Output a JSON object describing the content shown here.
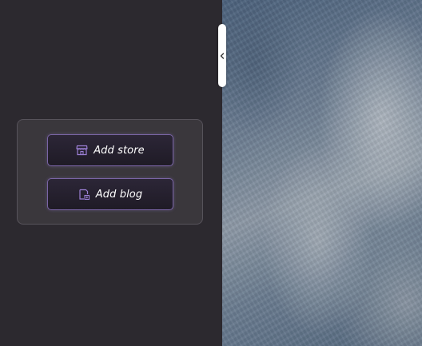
{
  "sidebar": {
    "actions": [
      {
        "label": "Add store",
        "icon": "store-icon"
      },
      {
        "label": "Add blog",
        "icon": "blog-add-icon"
      }
    ]
  },
  "handle": {
    "icon": "chevron-left-icon"
  },
  "colors": {
    "panel_bg": "#2c292f",
    "card_bg": "#3a373c",
    "button_border": "#7a65a6",
    "icon_accent": "#9b7fd4"
  }
}
